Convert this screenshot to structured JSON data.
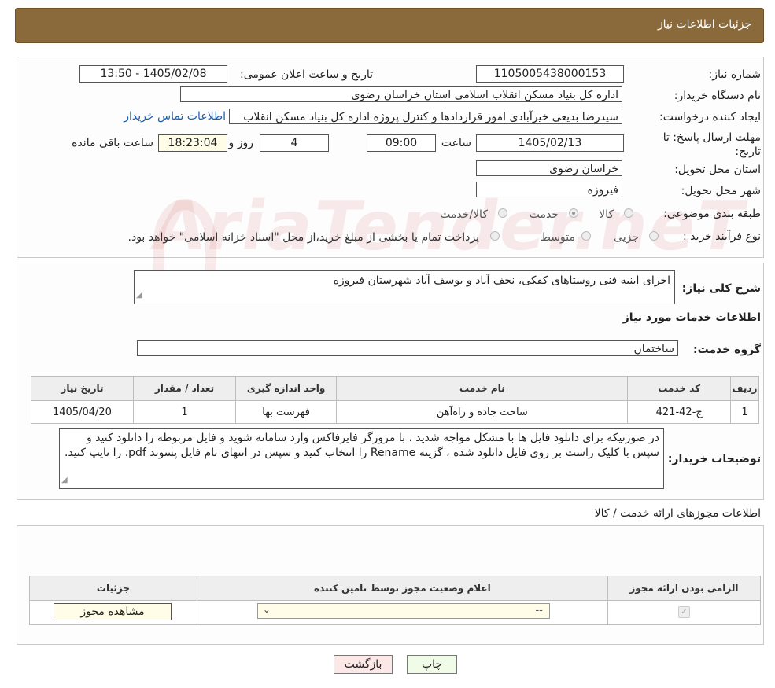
{
  "header": {
    "title": "جزئیات اطلاعات نیاز"
  },
  "need": {
    "number_label": "شماره نیاز:",
    "number_value": "1105005438000153",
    "announce_label": "تاریخ و ساعت اعلان عمومی:",
    "announce_value": "1405/02/08 - 13:50",
    "buyer_label": "نام دستگاه خریدار:",
    "buyer_value": "اداره کل بنیاد مسکن انقلاب اسلامی استان خراسان رضوی",
    "creator_label": "ایجاد کننده درخواست:",
    "creator_value": "سیدرضا بدیعی خیرآبادی امور قراردادها و کنترل پروژه اداره کل بنیاد مسکن انقلاب",
    "contact_link": "اطلاعات تماس خریدار",
    "deadline_label": "مهلت ارسال پاسخ: تا تاریخ:",
    "deadline_date": "1405/02/13",
    "time_label": "ساعت",
    "deadline_time": "09:00",
    "days_value": "4",
    "days_label": "روز و",
    "remaining_value": "18:23:04",
    "remaining_label": "ساعت باقی مانده",
    "province_label": "استان محل تحویل:",
    "province_value": "خراسان رضوی",
    "city_label": "شهر محل تحویل:",
    "city_value": "فیروزه",
    "category_label": "طبقه بندی موضوعی:",
    "category_options": [
      "کالا",
      "خدمت",
      "کالا/خدمت"
    ],
    "category_selected": "خدمت",
    "purchase_label": "نوع فرآیند خرید :",
    "purchase_options": [
      "جزیی",
      "متوسط"
    ],
    "purchase_note": "پرداخت تمام یا بخشی از مبلغ خرید،از محل \"اسناد خزانه اسلامی\" خواهد بود."
  },
  "summary": {
    "label": "شرح کلی نیاز:",
    "value": "اجرای ابنیه فنی روستاهای کفکی، نجف آباد و یوسف آباد شهرستان فیروزه"
  },
  "services": {
    "section_title": "اطلاعات خدمات مورد نیاز",
    "group_label": "گروه خدمت:",
    "group_value": "ساختمان",
    "columns": [
      "ردیف",
      "کد خدمت",
      "نام خدمت",
      "واحد اندازه گیری",
      "تعداد / مقدار",
      "تاریخ نیاز"
    ],
    "rows": [
      {
        "row": "1",
        "code": "ج-42-421",
        "name": "ساخت جاده و راه‌آهن",
        "unit": "فهرست بها",
        "qty": "1",
        "date": "1405/04/20"
      }
    ]
  },
  "buyer_notes": {
    "label": "توضیحات خریدار:",
    "value": "در صورتیکه برای دانلود فایل ها با مشکل مواجه شدید ، با مرورگر فایرفاکس وارد سامانه شوید و فایل مربوطه را دانلود کنید و سپس با کلیک راست بر روی فایل دانلود شده ، گزینه Rename را انتخاب کنید و سپس در انتهای نام فایل پسوند pdf. را تایپ کنید."
  },
  "permits": {
    "section_title": "اطلاعات مجوزهای ارائه خدمت / کالا",
    "columns": [
      "الزامی بودن ارائه مجوز",
      "اعلام وضعیت مجوز توسط تامین کننده",
      "جزئیات"
    ],
    "select_value": "--",
    "view_button": "مشاهده مجوز"
  },
  "actions": {
    "print": "چاپ",
    "back": "بازگشت"
  },
  "watermark": "AriaTender.neT",
  "colors": {
    "header_bg": "#8a6a3a",
    "link": "#1a5fb4",
    "back_button_bg": "#fde8e8",
    "print_button_bg": "#f0fbe8"
  }
}
